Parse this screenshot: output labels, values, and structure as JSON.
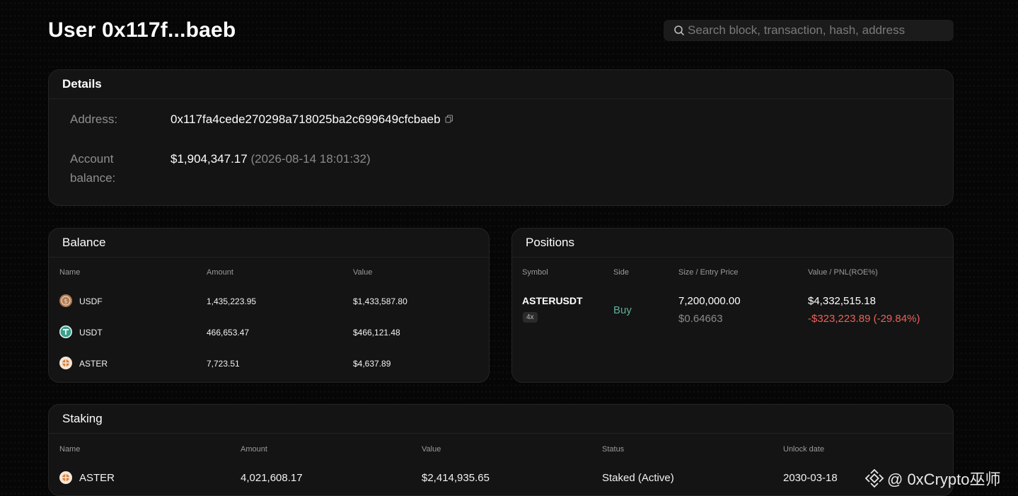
{
  "header": {
    "title": "User 0x117f...baeb",
    "search_placeholder": "Search block, transaction, hash, address"
  },
  "details": {
    "title": "Details",
    "address_label": "Address:",
    "address_value": "0x117fa4cede270298a718025ba2c699649cfcbaeb",
    "balance_label_1": "Account",
    "balance_label_2": "balance:",
    "balance_value": "$1,904,347.17",
    "balance_time": "(2026-08-14 18:01:32)"
  },
  "balance": {
    "title": "Balance",
    "columns": [
      "Name",
      "Amount",
      "Value"
    ],
    "rows": [
      {
        "name": "USDF",
        "amount": "1,435,223.95",
        "value": "$1,433,587.80"
      },
      {
        "name": "USDT",
        "amount": "466,653.47",
        "value": "$466,121.48"
      },
      {
        "name": "ASTER",
        "amount": "7,723.51",
        "value": "$4,637.89"
      }
    ]
  },
  "positions": {
    "title": "Positions",
    "columns": [
      "Symbol",
      "Side",
      "Size / Entry Price",
      "Value / PNL(ROE%)"
    ],
    "rows": [
      {
        "symbol": "ASTERUSDT",
        "leverage": "4x",
        "side": "Buy",
        "size": "7,200,000.00",
        "entry_price": "$0.64663",
        "value": "$4,332,515.18",
        "pnl": "-$323,223.89 (-29.84%)"
      }
    ]
  },
  "staking": {
    "title": "Staking",
    "columns": [
      "Name",
      "Amount",
      "Value",
      "Status",
      "Unlock date"
    ],
    "rows": [
      {
        "name": "ASTER",
        "amount": "4,021,608.17",
        "value": "$2,414,935.65",
        "status": "Staked (Active)",
        "unlock": "2030-03-18"
      }
    ]
  },
  "watermark": {
    "text": "@ 0xCrypto巫师"
  },
  "colors": {
    "buy": "#5db09a",
    "pnl_negative": "#e9625a",
    "card_bg": "#141414"
  },
  "icons": {
    "search": "search-icon",
    "copy": "copy-icon",
    "usdf": "usdf-coin-icon",
    "usdt": "usdt-coin-icon",
    "aster": "aster-coin-icon",
    "binance": "binance-logo-icon"
  }
}
